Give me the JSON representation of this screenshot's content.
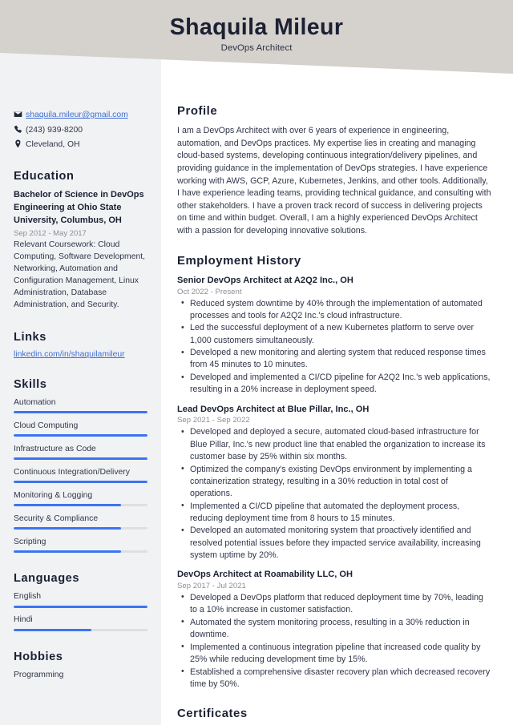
{
  "header": {
    "name": "Shaquila Mileur",
    "role": "DevOps Architect"
  },
  "colors": {
    "band": "#d5d1cc",
    "sidebar": "#f1f2f4",
    "accent": "#3b74f2",
    "link": "#3f6fd4",
    "heading": "#1b2133",
    "body": "#31374a",
    "muted": "#8d8f96"
  },
  "sidebar": {
    "contact": [
      {
        "icon": "email-icon",
        "text": "shaquila.mileur@gmail.com",
        "is_link": true
      },
      {
        "icon": "phone-icon",
        "text": "(243) 939-8200",
        "is_link": false
      },
      {
        "icon": "location-pin-icon",
        "text": "Cleveland, OH",
        "is_link": false
      }
    ],
    "education": {
      "heading": "Education",
      "degree": "Bachelor of Science in DevOps Engineering at Ohio State University, Columbus, OH",
      "dates": "Sep 2012 - May 2017",
      "description": "Relevant Coursework: Cloud Computing, Software Development, Networking, Automation and Configuration Management, Linux Administration, Database Administration, and Security."
    },
    "links": {
      "heading": "Links",
      "items": [
        {
          "label": "linkedin.com/in/shaquilamileur"
        }
      ]
    },
    "skills": {
      "heading": "Skills",
      "items": [
        {
          "label": "Automation",
          "level": 100
        },
        {
          "label": "Cloud Computing",
          "level": 100
        },
        {
          "label": "Infrastructure as Code",
          "level": 100
        },
        {
          "label": "Continuous Integration/Delivery",
          "level": 100
        },
        {
          "label": "Monitoring & Logging",
          "level": 80
        },
        {
          "label": "Security & Compliance",
          "level": 80
        },
        {
          "label": "Scripting",
          "level": 80
        }
      ]
    },
    "languages": {
      "heading": "Languages",
      "items": [
        {
          "label": "English",
          "level": 100
        },
        {
          "label": "Hindi",
          "level": 58
        }
      ]
    },
    "hobbies": {
      "heading": "Hobbies",
      "items": [
        {
          "label": "Programming"
        }
      ]
    }
  },
  "main": {
    "profile": {
      "heading": "Profile",
      "text": "I am a DevOps Architect with over 6 years of experience in engineering, automation, and DevOps practices. My expertise lies in creating and managing cloud-based systems, developing continuous integration/delivery pipelines, and providing guidance in the implementation of DevOps strategies. I have experience working with AWS, GCP, Azure, Kubernetes, Jenkins, and other tools. Additionally, I have experience leading teams, providing technical guidance, and consulting with other stakeholders. I have a proven track record of success in delivering projects on time and within budget. Overall, I am a highly experienced DevOps Architect with a passion for developing innovative solutions."
    },
    "employment": {
      "heading": "Employment History",
      "jobs": [
        {
          "title": "Senior DevOps Architect at A2Q2 Inc., OH",
          "dates": "Oct 2022 - Present",
          "bullets": [
            "Reduced system downtime by 40% through the implementation of automated processes and tools for A2Q2 Inc.'s cloud infrastructure.",
            "Led the successful deployment of a new Kubernetes platform to serve over 1,000 customers simultaneously.",
            "Developed a new monitoring and alerting system that reduced response times from 45 minutes to 10 minutes.",
            "Developed and implemented a CI/CD pipeline for A2Q2 Inc.'s web applications, resulting in a 20% increase in deployment speed."
          ]
        },
        {
          "title": "Lead DevOps Architect at Blue Pillar, Inc., OH",
          "dates": "Sep 2021 - Sep 2022",
          "bullets": [
            "Developed and deployed a secure, automated cloud-based infrastructure for Blue Pillar, Inc.'s new product line that enabled the organization to increase its customer base by 25% within six months.",
            "Optimized the company's existing DevOps environment by implementing a containerization strategy, resulting in a 30% reduction in total cost of operations.",
            "Implemented a CI/CD pipeline that automated the deployment process, reducing deployment time from 8 hours to 15 minutes.",
            "Developed an automated monitoring system that proactively identified and resolved potential issues before they impacted service availability, increasing system uptime by 20%."
          ]
        },
        {
          "title": "DevOps Architect at Roamability LLC, OH",
          "dates": "Sep 2017 - Jul 2021",
          "bullets": [
            "Developed a DevOps platform that reduced deployment time by 70%, leading to a 10% increase in customer satisfaction.",
            "Automated the system monitoring process, resulting in a 30% reduction in downtime.",
            "Implemented a continuous integration pipeline that increased code quality by 25% while reducing development time by 15%.",
            "Established a comprehensive disaster recovery plan which decreased recovery time by 50%."
          ]
        }
      ]
    },
    "certificates": {
      "heading": "Certificates"
    }
  }
}
